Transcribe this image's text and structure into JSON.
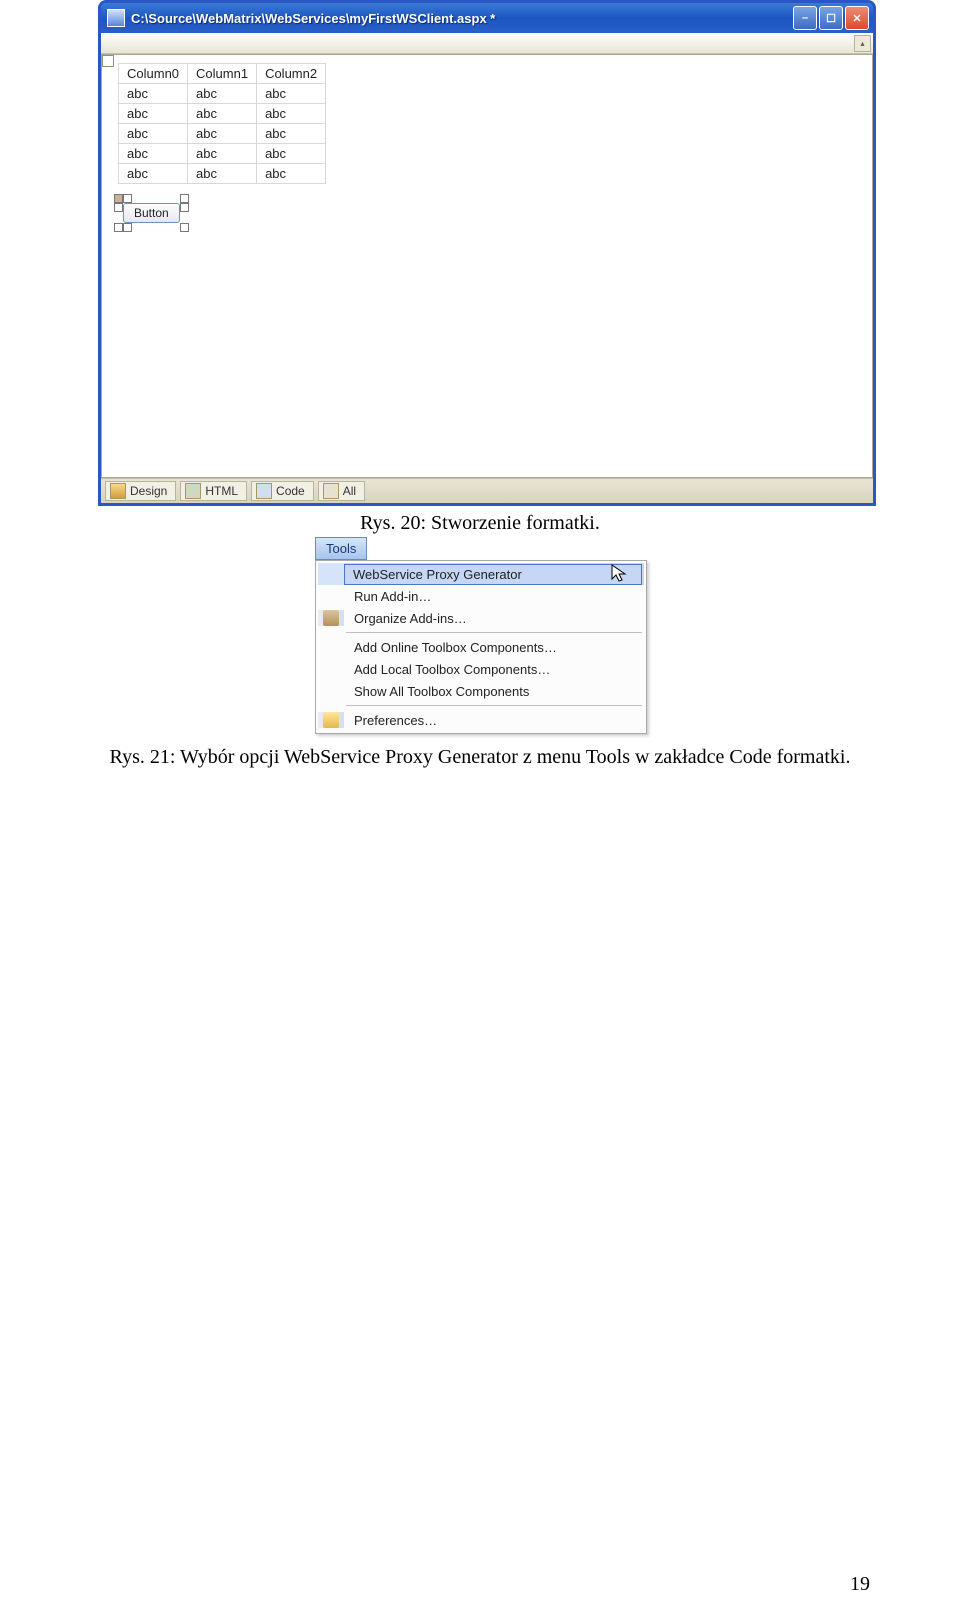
{
  "screenshot1": {
    "title": "C:\\Source\\WebMatrix\\WebServices\\myFirstWSClient.aspx *",
    "grid": {
      "headers": [
        "Column0",
        "Column1",
        "Column2"
      ],
      "rows": [
        [
          "abc",
          "abc",
          "abc"
        ],
        [
          "abc",
          "abc",
          "abc"
        ],
        [
          "abc",
          "abc",
          "abc"
        ],
        [
          "abc",
          "abc",
          "abc"
        ],
        [
          "abc",
          "abc",
          "abc"
        ]
      ]
    },
    "button_label": "Button",
    "tabs": {
      "design": "Design",
      "html": "HTML",
      "code": "Code",
      "all": "All"
    }
  },
  "caption1": "Rys. 20: Stworzenie formatki.",
  "screenshot2": {
    "menu_button": "Tools",
    "items": {
      "proxy": "WebService Proxy Generator",
      "run_addin": "Run Add-in…",
      "organize": "Organize Add-ins…",
      "add_online": "Add Online Toolbox Components…",
      "add_local": "Add Local Toolbox Components…",
      "show_all": "Show All Toolbox Components",
      "prefs": "Preferences…"
    }
  },
  "caption2": "Rys. 21: Wybór opcji WebService Proxy Generator z menu Tools w zakładce Code formatki.",
  "page_number": "19"
}
